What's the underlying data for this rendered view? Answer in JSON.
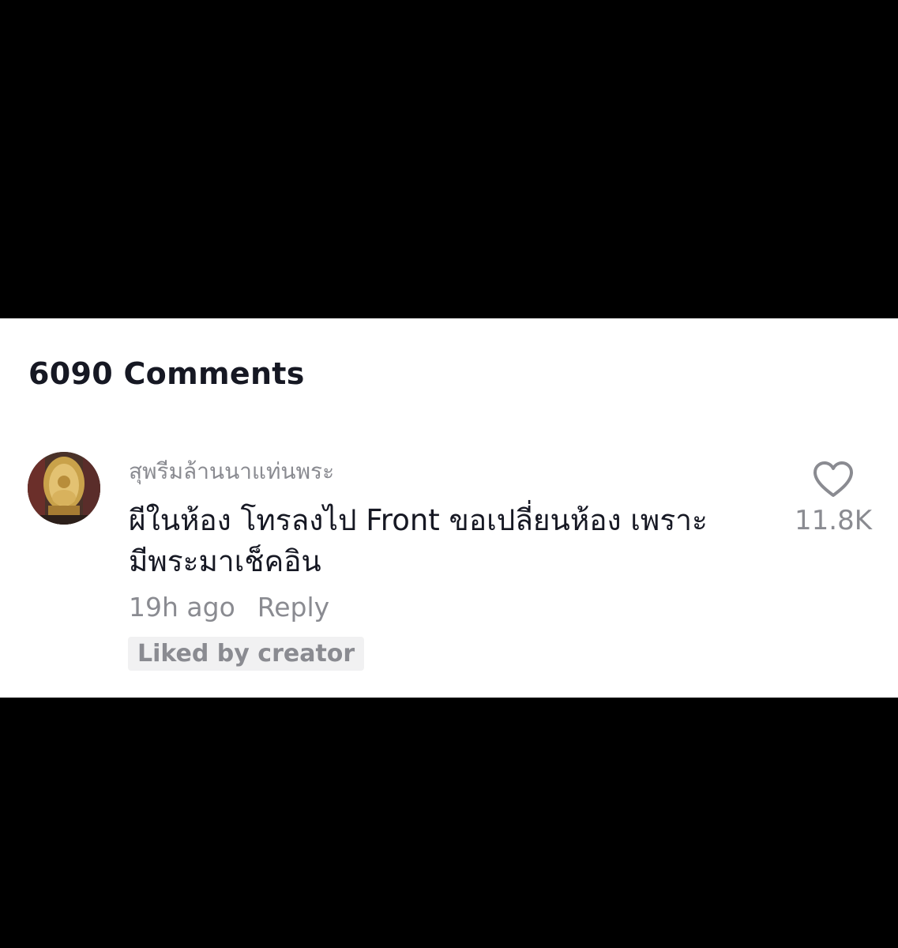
{
  "comments_header": "6090 Comments",
  "comment": {
    "username": "สุพรีมล้านนาแท่นพระ",
    "text_line1": "ผีในห้อง โทรลงไป Front ขอเปลี่ยนห้อง เพราะ",
    "text_line2": "มีพระมาเช็คอิน",
    "time": "19h ago",
    "reply_label": "Reply",
    "liked_badge": "Liked by creator",
    "like_count": "11.8K",
    "like_icon": "heart-outline-icon"
  },
  "colors": {
    "background": "#000000",
    "panel": "#ffffff",
    "primary_text": "#161823",
    "secondary_text": "#8a8b91",
    "badge_bg": "#f1f1f2"
  }
}
